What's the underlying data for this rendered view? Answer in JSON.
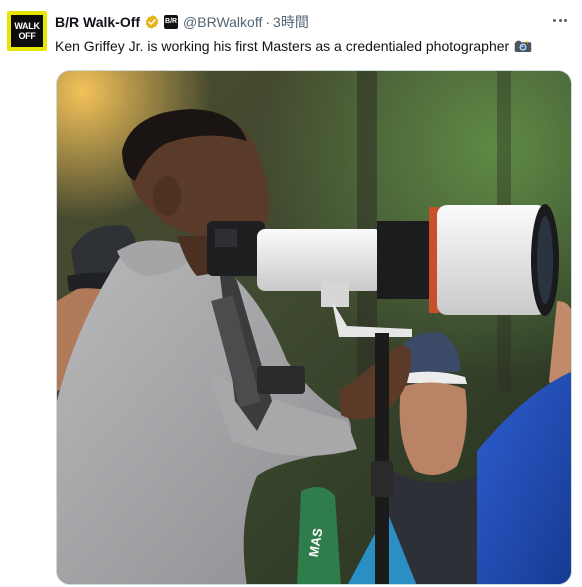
{
  "tweet": {
    "display_name": "B/R Walk-Off",
    "avatar_text_line1": "WALK",
    "avatar_text_line2": "OFF",
    "affiliate_badge": "B/R",
    "handle": "@BRWalkoff",
    "separator": "·",
    "timestamp": "3時間",
    "text": "Ken Griffey Jr. is working his first Masters as a credentialed photographer",
    "emoji": "camera-with-flash-emoji",
    "icons": {
      "verified": "verified-badge-icon",
      "more": "more-options-icon"
    },
    "colors": {
      "verified_badge": "#e8b21c",
      "avatar_yellow": "#e8e600",
      "secondary_text": "#536471"
    }
  },
  "photo": {
    "description_free": "",
    "visible_text": "MAS"
  }
}
